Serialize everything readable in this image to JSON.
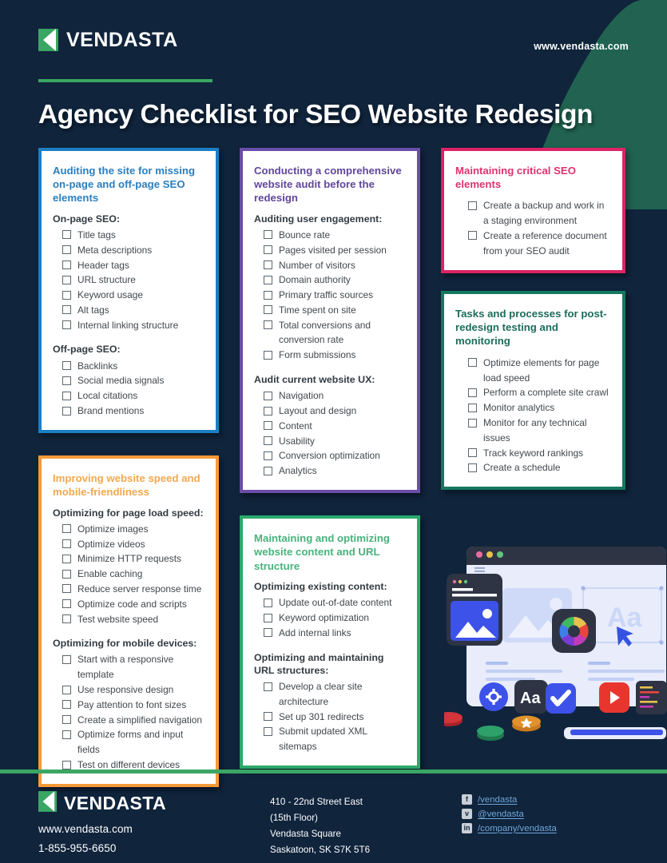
{
  "brand": {
    "name": "VENDASTA",
    "website": "www.vendasta.com",
    "accent_green": "#3aa664",
    "background": "#10243c",
    "wedge_green": "#1f5c4d"
  },
  "header": {
    "logo_text": "VENDASTA",
    "url_text": "www.vendasta.com",
    "title": "Agency Checklist for SEO Website Redesign"
  },
  "cards": [
    {
      "id": "auditing-site",
      "color": "#2a7fc1",
      "border": "#1c7fc4",
      "title": "Auditing the site for missing on-page and off-page SEO elements",
      "sections": [
        {
          "heading": "On-page SEO:",
          "items": [
            "Title tags",
            "Meta descriptions",
            "Header tags",
            "URL structure",
            "Keyword usage",
            "Alt tags",
            "Internal linking structure"
          ]
        },
        {
          "heading": "Off-page SEO:",
          "items": [
            "Backlinks",
            "Social media signals",
            "Local citations",
            "Brand mentions"
          ]
        }
      ]
    },
    {
      "id": "improving-speed",
      "color": "#f5a84e",
      "border": "#f59a39",
      "title": "Improving website speed and mobile-friendliness",
      "sections": [
        {
          "heading": "Optimizing for page load speed:",
          "items": [
            "Optimize images",
            "Optimize videos",
            "Minimize HTTP requests",
            "Enable caching",
            "Reduce server response time",
            "Optimize code and scripts",
            "Test website speed"
          ]
        },
        {
          "heading": "Optimizing for mobile devices:",
          "items": [
            "Start with a responsive template",
            "Use responsive design",
            "Pay attention to font sizes",
            "Create a simplified navigation",
            "Optimize forms and input fields",
            "Test on different devices"
          ]
        }
      ]
    },
    {
      "id": "conducting-audit",
      "color": "#60469c",
      "border": "#6b4ea8",
      "title": "Conducting a comprehensive website audit before the redesign",
      "sections": [
        {
          "heading": "Auditing user engagement:",
          "items": [
            "Bounce rate",
            "Pages visited per session",
            "Number of visitors",
            "Domain authority",
            "Primary traffic sources",
            "Time spent on site",
            "Total conversions and conversion rate",
            "Form submissions"
          ]
        },
        {
          "heading": "Audit current website UX:",
          "items": [
            "Navigation",
            "Layout and design",
            "Content",
            "Usability",
            "Conversion optimization",
            "Analytics"
          ]
        }
      ]
    },
    {
      "id": "maintaining-content",
      "color": "#46b37b",
      "border": "#2aa86a",
      "title": "Maintaining and optimizing website content and URL structure",
      "sections": [
        {
          "heading": "Optimizing existing content:",
          "items": [
            "Update out-of-date content",
            "Keyword optimization",
            "Add internal links"
          ]
        },
        {
          "heading": "Optimizing and maintaining URL structures:",
          "items": [
            "Develop a clear site architecture",
            "Set up 301 redirects",
            "Submit updated XML sitemaps"
          ]
        }
      ]
    },
    {
      "id": "maintaining-critical",
      "color": "#e0326e",
      "border": "#dd2365",
      "title": "Maintaining critical SEO elements",
      "sections": [
        {
          "heading": "",
          "items": [
            "Create a backup and work in a staging environment",
            "Create a reference document from your SEO audit"
          ]
        }
      ]
    },
    {
      "id": "tasks-processes",
      "color": "#1c6d5a",
      "border": "#14795f",
      "title": "Tasks and processes for post-redesign testing and monitoring",
      "sections": [
        {
          "heading": "",
          "items": [
            "Optimize elements for page load speed",
            "Perform a complete site crawl",
            "Monitor analytics",
            "Monitor for any technical issues",
            "Track keyword rankings",
            "Create a schedule"
          ]
        }
      ]
    }
  ],
  "footer": {
    "logo_text": "VENDASTA",
    "website": "www.vendasta.com",
    "phone": "1-855-955-6650",
    "address": [
      "410 - 22nd Street East",
      "(15th Floor)",
      "Vendasta Square",
      "Saskatoon, SK S7K 5T6"
    ],
    "social": [
      {
        "icon": "facebook-icon",
        "glyph": "f",
        "label": "/vendasta"
      },
      {
        "icon": "twitter-icon",
        "glyph": "ᴠ",
        "label": "@vendasta"
      },
      {
        "icon": "linkedin-icon",
        "glyph": "in",
        "label": "/company/vendasta"
      }
    ]
  },
  "illustration": {
    "name": "web-design-tools-illustration",
    "elements": [
      "browser-window",
      "image-card",
      "color-wheel-app",
      "typography-panel",
      "gear-icon",
      "aa-icon",
      "checkmark-icon",
      "youtube-icon",
      "code-panel",
      "cursor-arrow",
      "poker-chips"
    ]
  }
}
